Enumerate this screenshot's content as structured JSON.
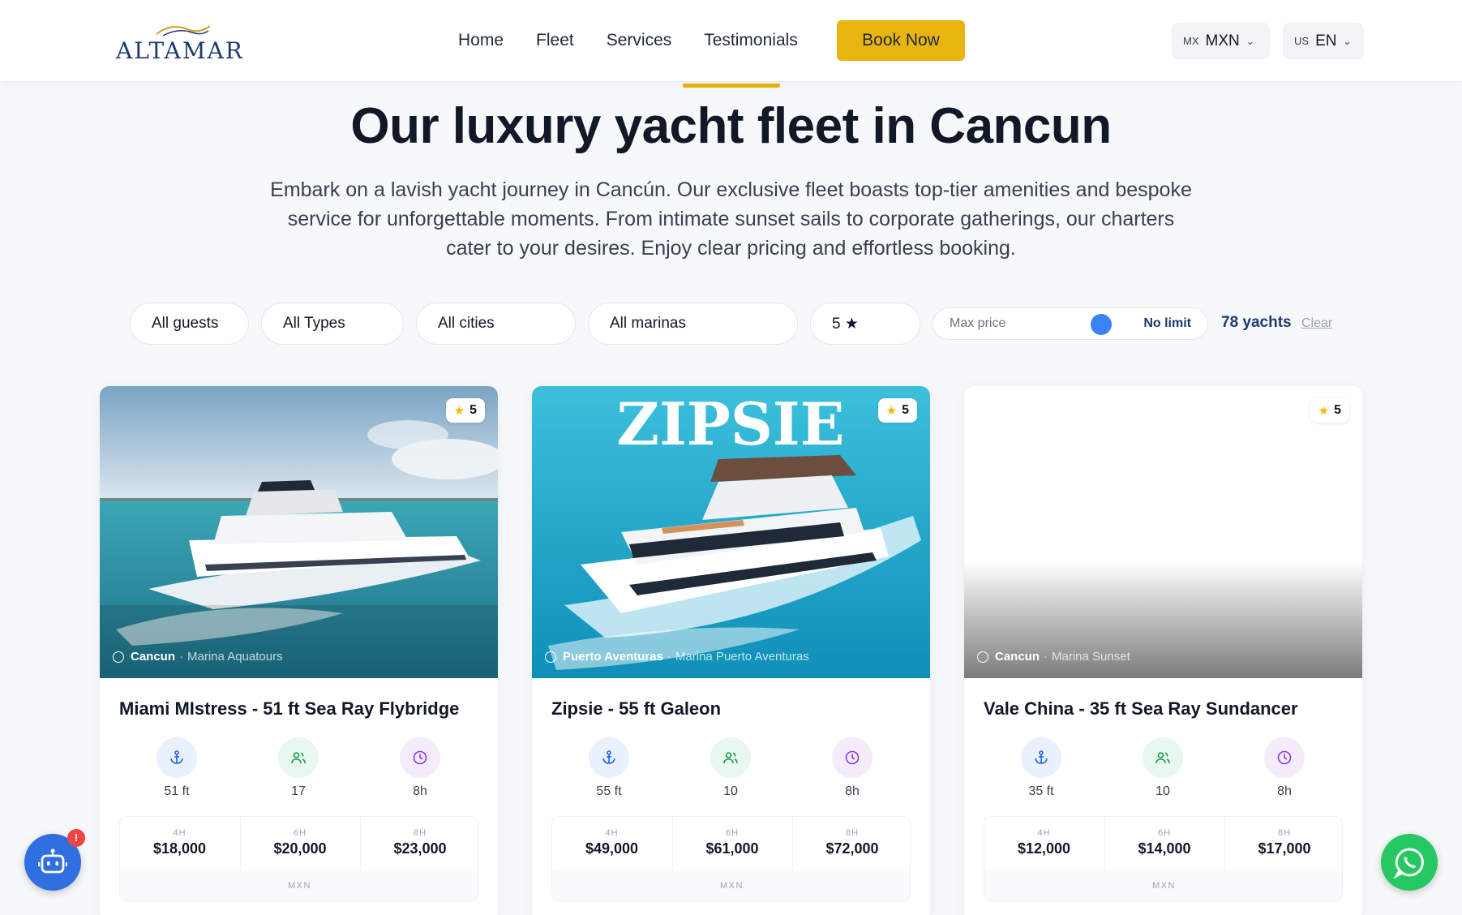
{
  "brand": {
    "logo_text": "ALTAMAR"
  },
  "nav": {
    "items": [
      {
        "label": "Home"
      },
      {
        "label": "Fleet"
      },
      {
        "label": "Services"
      },
      {
        "label": "Testimonials"
      }
    ],
    "book_label": "Book Now",
    "currency": {
      "flag": "MX",
      "value": "MXN"
    },
    "language": {
      "flag": "US",
      "value": "EN"
    }
  },
  "hero": {
    "title": "Our luxury yacht fleet in Cancun",
    "description": "Embark on a lavish yacht journey in Cancún. Our exclusive fleet boasts top-tier amenities and bespoke service for unforgettable moments. From intimate sunset sails to corporate gatherings, our charters cater to your desires. Enjoy clear pricing and effortless booking."
  },
  "filters": {
    "guests": "All guests",
    "types": "All Types",
    "cities": "All cities",
    "marinas": "All marinas",
    "rating": "5 ★",
    "price_label": "Max price",
    "price_value": "No limit",
    "price_level": 0.6,
    "count": "78 yachts",
    "clear": "Clear"
  },
  "cards": [
    {
      "title": "Miami MIstress - 51 ft Sea Ray Flybridge",
      "rating": "5",
      "city": "Cancun",
      "marina": "Marina Aquatours",
      "length": "51 ft",
      "guests": "17",
      "duration": "8h",
      "prices": [
        {
          "label": "4H",
          "amount": "$18,000"
        },
        {
          "label": "6H",
          "amount": "$20,000"
        },
        {
          "label": "8H",
          "amount": "$23,000"
        }
      ],
      "currency": "MXN"
    },
    {
      "title": "Zipsie - 55 ft Galeon",
      "image_text": "ZIPSIE",
      "rating": "5",
      "city": "Puerto Aventuras",
      "marina": "Marina Puerto Aventuras",
      "length": "55 ft",
      "guests": "10",
      "duration": "8h",
      "prices": [
        {
          "label": "4H",
          "amount": "$49,000"
        },
        {
          "label": "6H",
          "amount": "$61,000"
        },
        {
          "label": "8H",
          "amount": "$72,000"
        }
      ],
      "currency": "MXN"
    },
    {
      "title": "Vale China - 35 ft Sea Ray Sundancer",
      "rating": "5",
      "city": "Cancun",
      "marina": "Marina Sunset",
      "length": "35 ft",
      "guests": "10",
      "duration": "8h",
      "prices": [
        {
          "label": "4H",
          "amount": "$12,000"
        },
        {
          "label": "6H",
          "amount": "$14,000"
        },
        {
          "label": "8H",
          "amount": "$17,000"
        }
      ],
      "currency": "MXN"
    }
  ],
  "floating": {
    "bot_badge": "!"
  },
  "colors": {
    "accent": "#e8b410",
    "navy": "#1e3a6e",
    "whatsapp": "#25c861",
    "bot": "#2f6fe0"
  }
}
